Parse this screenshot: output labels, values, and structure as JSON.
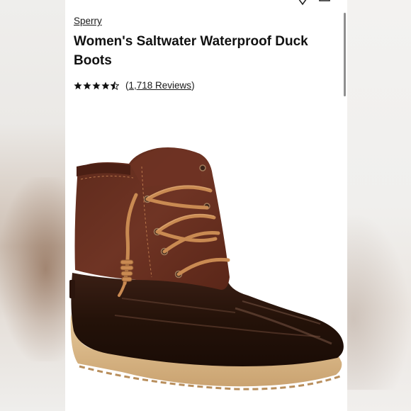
{
  "product": {
    "brand": "Sperry",
    "title": "Women's Saltwater Waterproof Duck Boots",
    "rating": 4.5,
    "reviews_label": "1,718 Reviews"
  },
  "icons": {
    "favorite": "heart-icon",
    "bag": "shopping-bag-icon",
    "rating": "star-icon"
  },
  "colors": {
    "text": "#111111",
    "leather": "#6b3122",
    "rubber": "#2a160f",
    "sole": "#d9b98a",
    "lace": "#c98a52"
  }
}
